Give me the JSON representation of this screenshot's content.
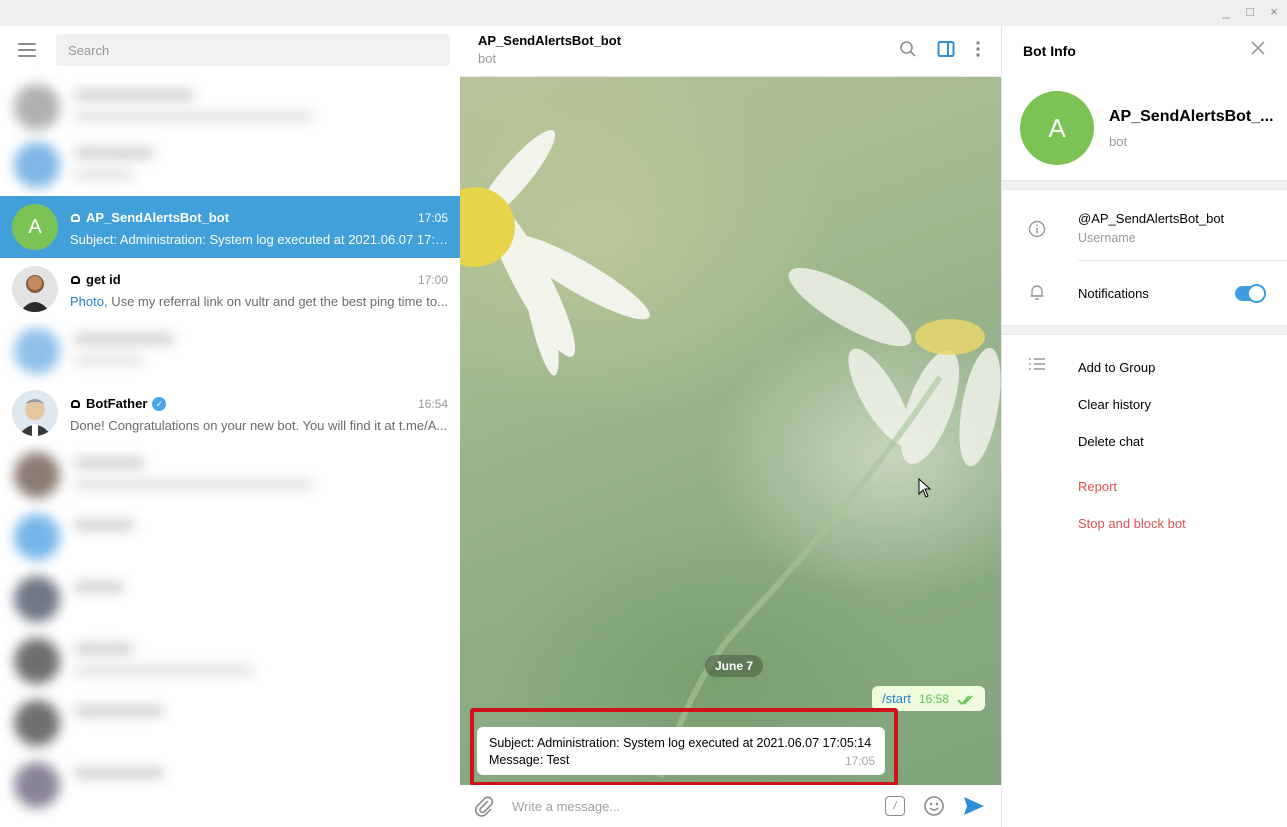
{
  "window": {
    "minimize": "_",
    "maximize": "□",
    "close": "×"
  },
  "sidebar": {
    "search_placeholder": "Search",
    "chats": [
      {
        "name": "AP_SendAlertsBot_bot",
        "time": "17:05",
        "message": "Subject: Administration: System log executed at 2021.06.07 17:05...",
        "avatar_letter": "A",
        "avatar_color": "#7ac354",
        "active": true,
        "bot": true
      },
      {
        "name": "get id",
        "time": "17:00",
        "message_prefix": "Photo,",
        "message": " Use my referral link on vultr and get the best ping time to...",
        "bot": true
      },
      {
        "name": "BotFather",
        "time": "16:54",
        "message": "Done! Congratulations on your new bot. You will find it at t.me/A...",
        "bot": true,
        "verified": true
      }
    ]
  },
  "chat": {
    "title": "AP_SendAlertsBot_bot",
    "subtitle": "bot",
    "date_pill": "June 7",
    "outgoing": {
      "text": "/start",
      "time": "16:58"
    },
    "incoming": {
      "line1": "Subject: Administration: System log executed at 2021.06.07 17:05:14",
      "line2": "Message: Test",
      "time": "17:05"
    },
    "composer_placeholder": "Write a message..."
  },
  "info": {
    "header": "Bot Info",
    "name": "AP_SendAlertsBot_...",
    "status": "bot",
    "avatar_letter": "A",
    "username": "@AP_SendAlertsBot_bot",
    "username_label": "Username",
    "notifications_label": "Notifications",
    "notifications_on": true,
    "actions": [
      "Add to Group",
      "Clear history",
      "Delete chat"
    ],
    "danger_actions": [
      "Report",
      "Stop and block bot"
    ]
  },
  "colors": {
    "accent": "#419fd9",
    "avatar_green": "#7ac354",
    "danger": "#e05050",
    "highlight": "#d0121b"
  }
}
